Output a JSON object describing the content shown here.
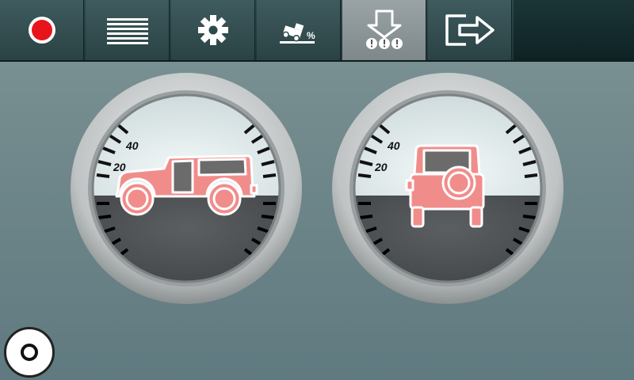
{
  "toolbar": {
    "buttons": [
      {
        "id": "record",
        "icon": "record-icon",
        "active": false
      },
      {
        "id": "menu",
        "icon": "menu-lines-icon",
        "active": false
      },
      {
        "id": "settings",
        "icon": "gear-icon",
        "active": false
      },
      {
        "id": "incline",
        "icon": "vehicle-incline-percent-icon",
        "active": false
      },
      {
        "id": "warning",
        "icon": "down-arrow-warning-icon",
        "active": true
      },
      {
        "id": "exit",
        "icon": "exit-icon",
        "active": false
      }
    ],
    "percent_glyph": "%"
  },
  "colors": {
    "record_dot": "#e8141c",
    "sky": "#dfe9ea",
    "ground": "#4b4f51",
    "vehicle_fill": "#f08d8b",
    "vehicle_outline": "#ffffff"
  },
  "gauges": {
    "pitch": {
      "labels": [
        "40",
        "20"
      ],
      "vehicle": "side-view"
    },
    "roll": {
      "labels": [
        "40",
        "20"
      ],
      "vehicle": "rear-view"
    }
  }
}
